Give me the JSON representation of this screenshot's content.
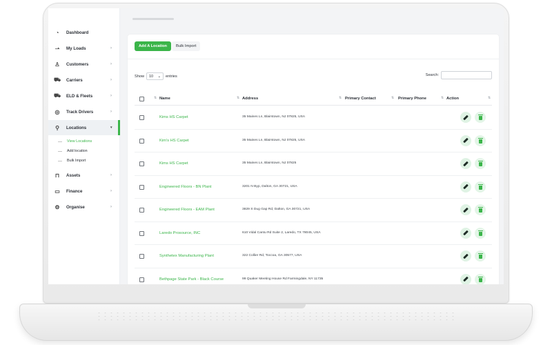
{
  "sidebar": {
    "items": [
      {
        "label": "Dashboard",
        "icon": "dashboard-icon",
        "glyph": "◔",
        "chevron": ""
      },
      {
        "label": "My Loads",
        "icon": "loads-icon",
        "glyph": "⇀",
        "chevron": "›"
      },
      {
        "label": "Customers",
        "icon": "customers-icon",
        "glyph": "♙",
        "chevron": "›"
      },
      {
        "label": "Carriers",
        "icon": "truck-icon",
        "glyph": "⛟",
        "chevron": "›"
      },
      {
        "label": "ELD & Fleets",
        "icon": "fleet-icon",
        "glyph": "⛟",
        "chevron": "›"
      },
      {
        "label": "Track Drivers",
        "icon": "location-pin-icon",
        "glyph": "◎",
        "chevron": "›"
      },
      {
        "label": "Locations",
        "icon": "locations-icon",
        "glyph": "⚲",
        "chevron": "▾"
      },
      {
        "label": "Assets",
        "icon": "bag-icon",
        "glyph": "⊓",
        "chevron": "›"
      },
      {
        "label": "Finance",
        "icon": "calendar-icon",
        "glyph": "▭",
        "chevron": "›"
      },
      {
        "label": "Organise",
        "icon": "settings-icon",
        "glyph": "⚙",
        "chevron": "›"
      }
    ],
    "sub_items": [
      "View Locations",
      "Add location",
      "Bulk Import"
    ]
  },
  "actions": {
    "add_label": "Add A Location",
    "bulk_label": "Bulk Import"
  },
  "controls": {
    "show_label": "Show",
    "show_value": "10",
    "entries_label": "entries",
    "search_label": "Search:"
  },
  "table": {
    "headers": {
      "name": "Name",
      "address": "Address",
      "contact": "Primary Contact",
      "phone": "Primary Phone",
      "action": "Action"
    },
    "rows": [
      {
        "name": "Kims HS Carpet",
        "address": "35 Maines Ln, Blairstown, NJ 07825, USA"
      },
      {
        "name": "Kim's HS Carpet",
        "address": "35 Maines Ln, Blairstown, NJ 07825, USA"
      },
      {
        "name": "Kims HS Carpet",
        "address": "35 Maines Ln, Blairstown, NJ 07825"
      },
      {
        "name": "Engineered Floors - BN Plant",
        "address": "3201 N Byp, Dalton, GA 30721, USA"
      },
      {
        "name": "Engineered Floors - EAM Plant",
        "address": "3829 S Dug Gap Rd, Dalton, GA 30721, USA"
      },
      {
        "name": "Laredo Prosource, INC",
        "address": "610 Vidal Cantu Rd Suite 2, Laredo, TX 78045, USA"
      },
      {
        "name": "Synthetex Manufacturing Plant",
        "address": "322 Collier Rd, Toccoa, GA 30577, USA"
      },
      {
        "name": "Bethpage State Park - Black Course",
        "address": "99 Quaker Meeting House Rd Farmingdale, NY 11735"
      }
    ]
  },
  "colors": {
    "accent": "#3bb54a"
  }
}
